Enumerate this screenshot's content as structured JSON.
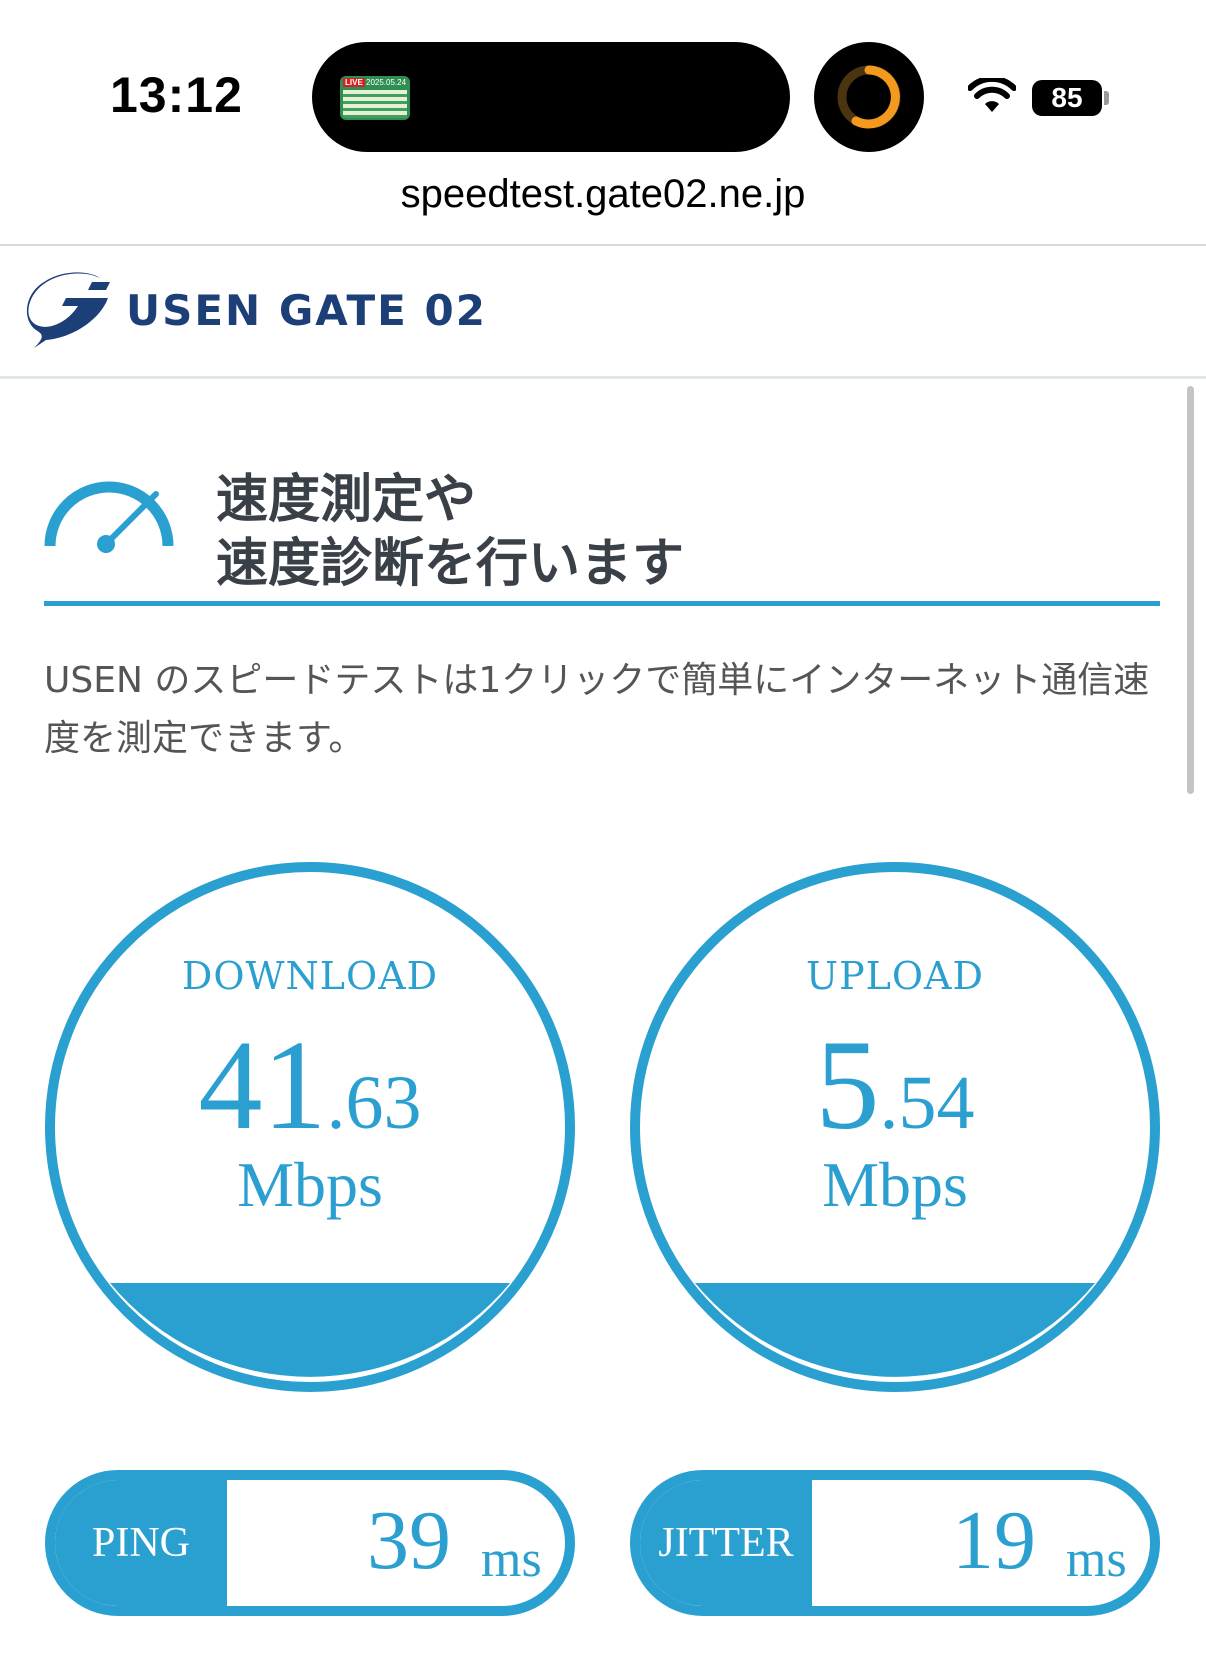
{
  "status_bar": {
    "time": "13:12",
    "live_badge": "LIVE",
    "live_date": "2025.05.24",
    "battery": "85"
  },
  "browser": {
    "url": "speedtest.gate02.ne.jp"
  },
  "site": {
    "logo_text": "USEN GATE 02",
    "brand_color": "#1d3f77",
    "accent_color": "#2aa0d0"
  },
  "intro": {
    "heading_line1": "速度測定や",
    "heading_line2": "速度診断を行います",
    "description": "USEN のスピードテストは1クリックで簡単にインターネット通信速度を測定できます。"
  },
  "results": {
    "download": {
      "label": "DOWNLOAD",
      "int": "41",
      "dec": ".63",
      "unit": "Mbps"
    },
    "upload": {
      "label": "UPLOAD",
      "int": "5",
      "dec": ".54",
      "unit": "Mbps"
    },
    "ping": {
      "label": "PING",
      "value": "39",
      "unit": "ms"
    },
    "jitter": {
      "label": "JITTER",
      "value": "19",
      "unit": "ms"
    }
  }
}
